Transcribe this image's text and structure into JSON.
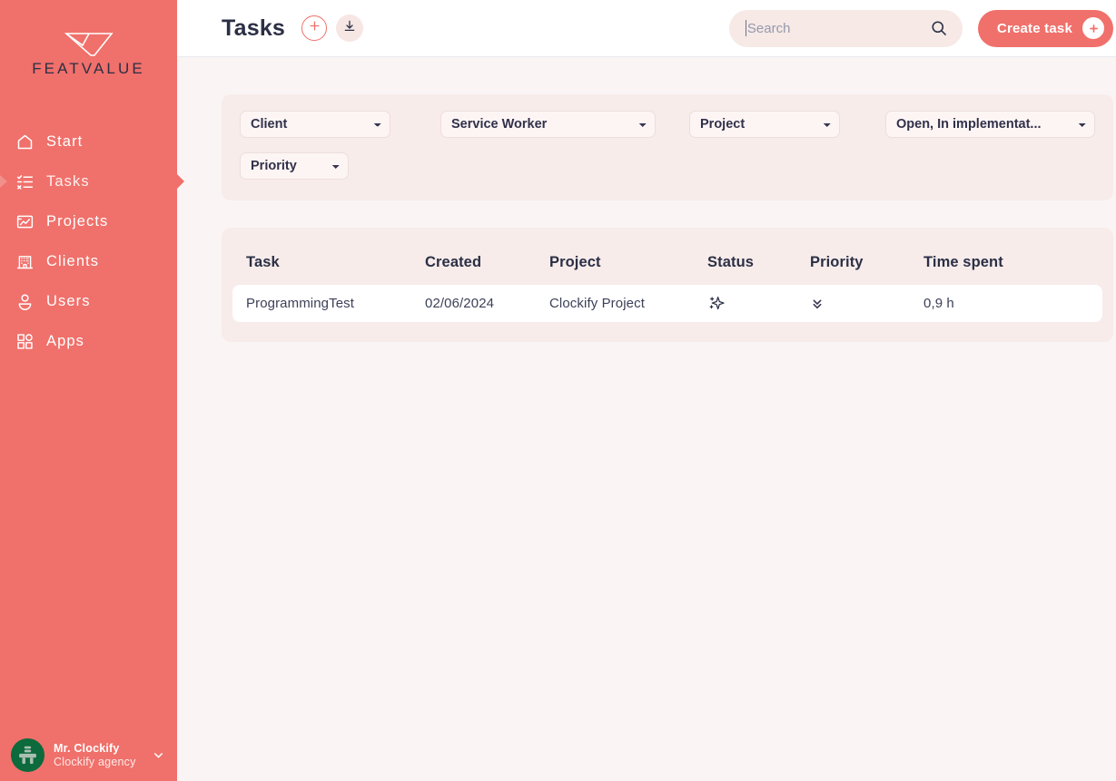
{
  "brand": {
    "name": "FEATVALUE",
    "logo_icon": "featvalue-funnel-logo",
    "sidebar_color": "#f0706b",
    "accent_color": "#f0706b",
    "text_dark": "#2b2f45"
  },
  "sidebar": {
    "items": [
      {
        "label": "Start",
        "icon": "home-icon",
        "active": false
      },
      {
        "label": "Tasks",
        "icon": "checklist-icon",
        "active": true
      },
      {
        "label": "Projects",
        "icon": "blueprint-icon",
        "active": false
      },
      {
        "label": "Clients",
        "icon": "building-icon",
        "active": false
      },
      {
        "label": "Users",
        "icon": "user-icon",
        "active": false
      },
      {
        "label": "Apps",
        "icon": "apps-grid-icon",
        "active": false
      }
    ],
    "profile": {
      "name": "Mr. Clockify",
      "org": "Clockify agency",
      "avatar_icon": "robot-avatar-icon",
      "avatar_color": "#0c6a3d",
      "caret_icon": "chevron-down-icon"
    }
  },
  "header": {
    "title": "Tasks",
    "add_icon": "plus-circle-icon",
    "download_icon": "download-icon"
  },
  "search": {
    "value": "",
    "placeholder": "Search",
    "icon": "search-icon"
  },
  "create_task": {
    "label": "Create task",
    "icon": "plus-icon"
  },
  "filters": [
    {
      "name": "client",
      "value": "Client",
      "icon": "chevron-down-icon"
    },
    {
      "name": "worker",
      "value": "Service Worker",
      "icon": "chevron-down-icon"
    },
    {
      "name": "project",
      "value": "Project",
      "icon": "chevron-down-icon"
    },
    {
      "name": "status",
      "value": "Open, In implementat...",
      "icon": "chevron-down-icon"
    },
    {
      "name": "priority",
      "value": "Priority",
      "icon": "chevron-down-icon"
    }
  ],
  "table": {
    "columns": [
      "Task",
      "Created",
      "Project",
      "Status",
      "Priority",
      "Time spent"
    ],
    "rows": [
      {
        "task": "ProgrammingTest",
        "created": "02/06/2024",
        "project": "Clockify Project",
        "status_icon": "sparkle-icon",
        "priority_icon": "double-chevron-down-icon",
        "time_spent": "0,9 h"
      }
    ]
  }
}
